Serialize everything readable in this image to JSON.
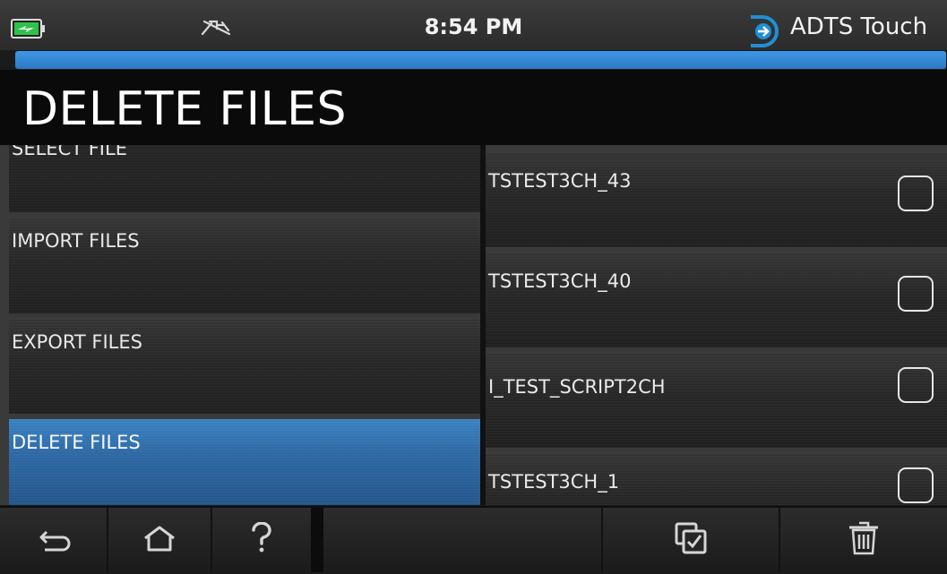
{
  "status_bar": {
    "time": "8:54 PM",
    "brand": "ADTS Touch",
    "icons": [
      "battery-charging-icon",
      "usb-disconnected-icon",
      "brand-logo-icon"
    ]
  },
  "header": {
    "title": "DELETE FILES"
  },
  "menu": {
    "items": [
      {
        "label": "SELECT FILE",
        "state": "partially-scrolled"
      },
      {
        "label": "IMPORT FILES"
      },
      {
        "label": "EXPORT FILES"
      },
      {
        "label": "DELETE FILES",
        "selected": true
      }
    ]
  },
  "files": [
    {
      "name": "TSTEST3CH_43",
      "checked": false
    },
    {
      "name": "TSTEST3CH_40",
      "checked": false
    },
    {
      "name": "I_TEST_SCRIPT2CH",
      "checked": false
    },
    {
      "name": "TSTEST3CH_1",
      "checked": false
    }
  ],
  "toolbar": {
    "buttons": [
      "back-icon",
      "home-icon",
      "help-icon",
      "select-all-icon",
      "delete-icon"
    ]
  },
  "colors": {
    "accent": "#2f86d4",
    "selected": "#2e6aa6",
    "background": "#2a2a2a"
  }
}
